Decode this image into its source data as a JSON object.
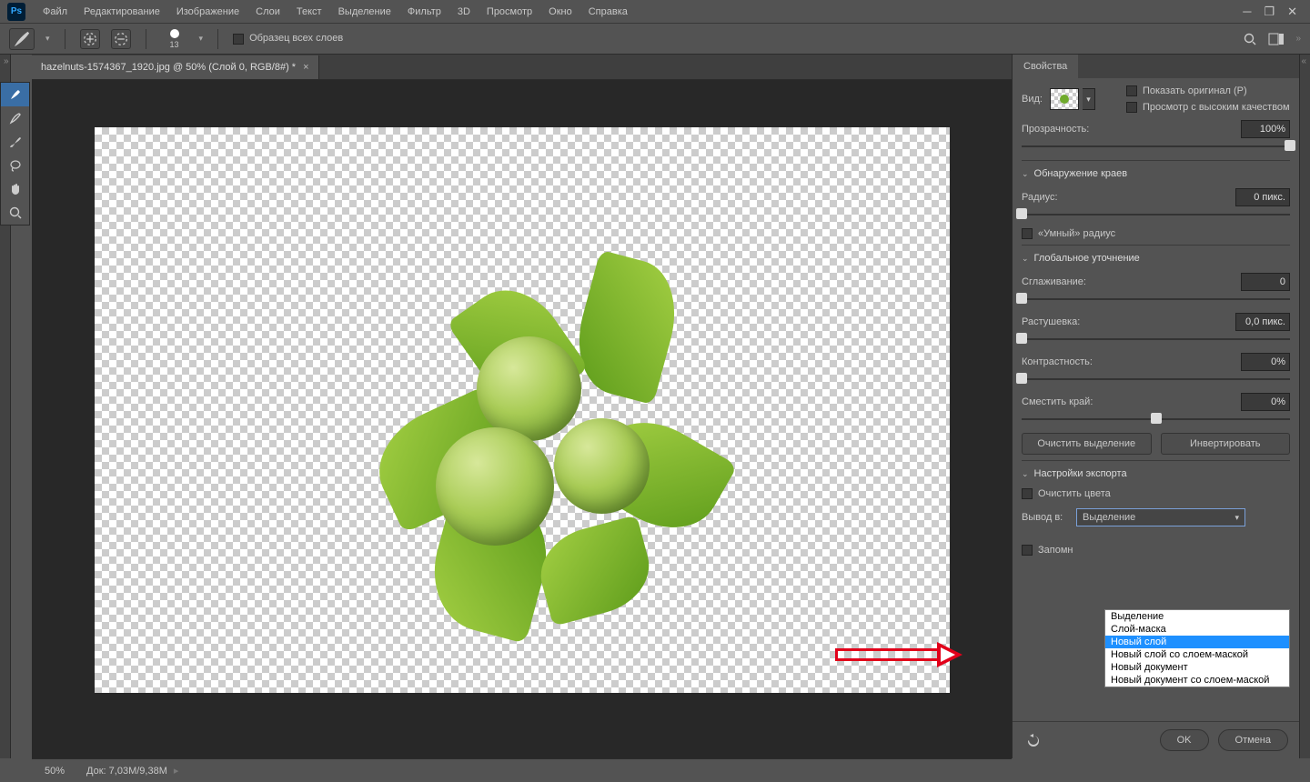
{
  "menubar": {
    "items": [
      "Файл",
      "Редактирование",
      "Изображение",
      "Слои",
      "Текст",
      "Выделение",
      "Фильтр",
      "3D",
      "Просмотр",
      "Окно",
      "Справка"
    ]
  },
  "optbar": {
    "brush_size": "13",
    "sample_all": "Образец всех слоев"
  },
  "doc": {
    "tab_title": "hazelnuts-1574367_1920.jpg @ 50% (Слой 0, RGB/8#) *"
  },
  "status": {
    "zoom": "50%",
    "docinfo_label": "Док:",
    "docinfo_value": "7,03M/9,38M"
  },
  "panel": {
    "tab": "Свойства",
    "view_label": "Вид:",
    "show_original": "Показать оригинал (P)",
    "high_quality": "Просмотр с высоким качеством",
    "opacity_label": "Прозрачность:",
    "opacity_value": "100%",
    "edge_section": "Обнаружение краев",
    "radius_label": "Радиус:",
    "radius_value": "0 пикс.",
    "smart_radius": "«Умный» радиус",
    "global_section": "Глобальное уточнение",
    "smooth_label": "Сглаживание:",
    "smooth_value": "0",
    "feather_label": "Растушевка:",
    "feather_value": "0,0 пикс.",
    "contrast_label": "Контрастность:",
    "contrast_value": "0%",
    "shift_label": "Сместить край:",
    "shift_value": "0%",
    "clear_sel": "Очистить выделение",
    "invert": "Инвертировать",
    "export_section": "Настройки экспорта",
    "decontaminate": "Очистить цвета",
    "output_label": "Вывод в:",
    "output_value": "Выделение",
    "remember": "Запомн",
    "ok": "OK",
    "cancel": "Отмена"
  },
  "dropdown": {
    "options": [
      "Выделение",
      "Слой-маска",
      "Новый слой",
      "Новый слой со слоем-маской",
      "Новый документ",
      "Новый документ со слоем-маской"
    ],
    "selected_index": 2
  }
}
